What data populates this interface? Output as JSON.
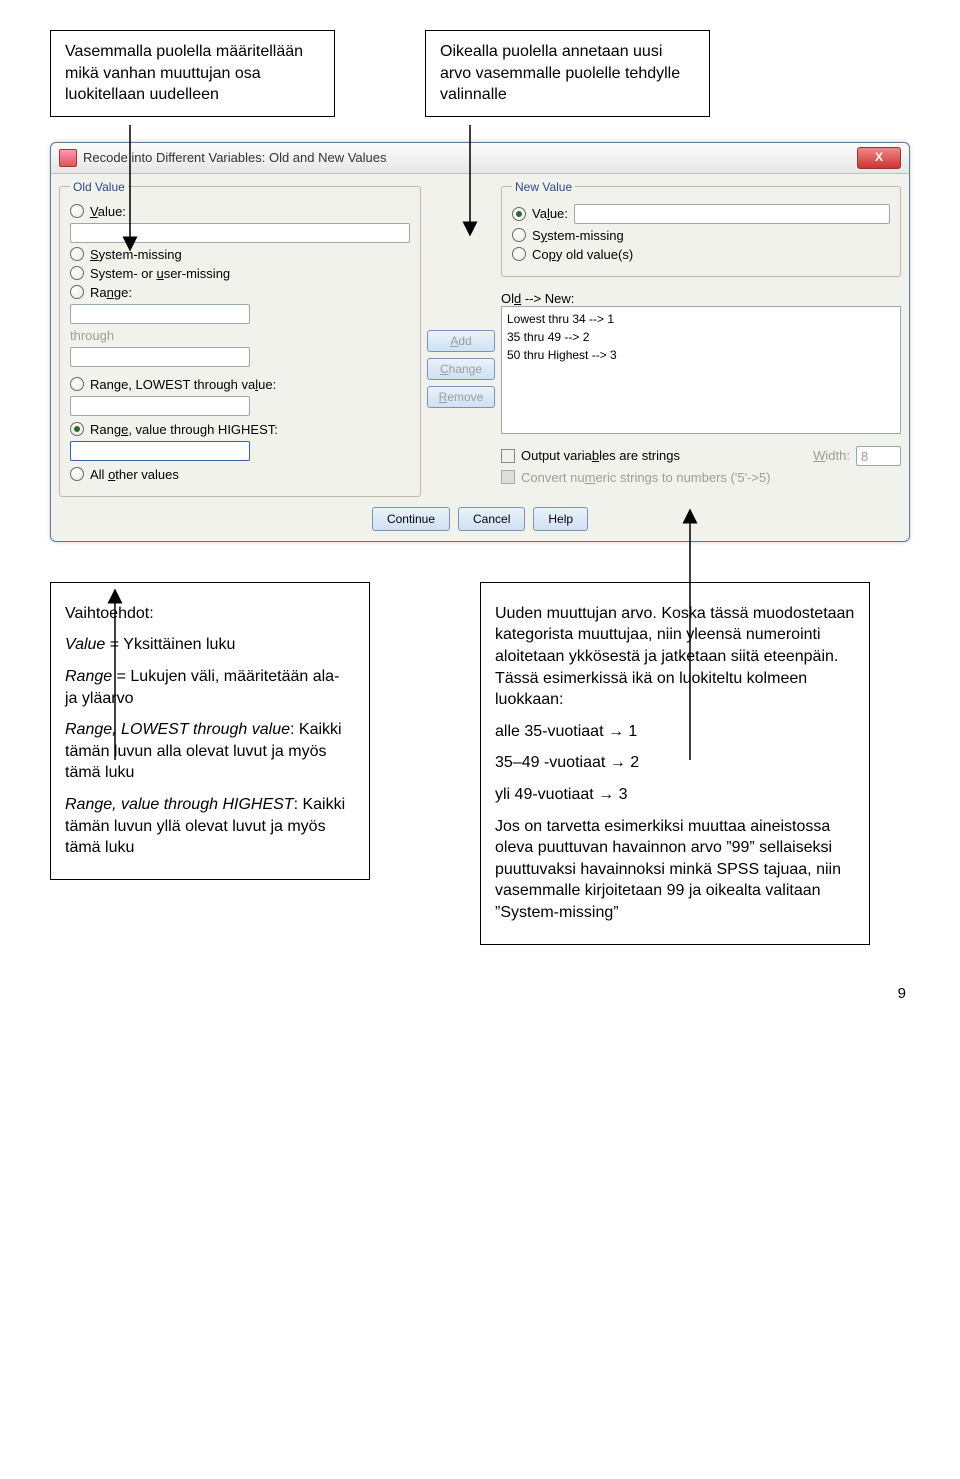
{
  "top_callouts": {
    "left": "Vasemmalla puolella määritellään mikä vanhan muuttujan osa luokitellaan uudelleen",
    "right": "Oikealla puolella annetaan uusi arvo vasemmalle puolelle tehdylle valinnalle"
  },
  "dialog": {
    "title": "Recode into Different Variables: Old and New Values",
    "close_glyph": "X",
    "old_value_legend": "Old Value",
    "new_value_legend": "New Value",
    "opt_value": "Value:",
    "opt_system_missing": "System-missing",
    "opt_system_or_user_missing": "System- or user-missing",
    "opt_range": "Range:",
    "through": "through",
    "opt_range_lowest": "Range, LOWEST through value:",
    "opt_range_highest": "Range, value through HIGHEST:",
    "opt_all_other": "All other values",
    "nv_value": "Value:",
    "nv_system_missing": "System-missing",
    "nv_copy_old": "Copy old value(s)",
    "old_new_label": "Old --> New:",
    "mapping_rows": [
      "Lowest thru 34 --> 1",
      "35 thru 49 --> 2",
      "50 thru Highest --> 3"
    ],
    "btn_add": "Add",
    "btn_change": "Change",
    "btn_remove": "Remove",
    "chk_output_strings": "Output variables are strings",
    "width_label": "Width:",
    "width_value": "8",
    "chk_convert_numeric": "Convert numeric strings to numbers ('5'->5)",
    "btn_continue": "Continue",
    "btn_cancel": "Cancel",
    "btn_help": "Help"
  },
  "bottom_callouts": {
    "left": {
      "heading": "Vaihtoehdot:",
      "items": [
        {
          "term": "Value",
          "desc": " = Yksittäinen luku"
        },
        {
          "term": "Range",
          "desc": " = Lukujen väli, määritetään ala- ja yläarvo"
        },
        {
          "term": "Range, LOWEST through value",
          "desc": ": Kaikki tämän luvun alla olevat luvut ja myös tämä luku"
        },
        {
          "term": "Range, value through HIGHEST",
          "desc": ": Kaikki tämän luvun yllä olevat luvut ja myös tämä luku"
        }
      ]
    },
    "right": {
      "p1": "Uuden muuttujan arvo. Koska tässä muodostetaan kategorista muuttujaa, niin yleensä numerointi aloitetaan ykkösestä ja jatketaan siitä eteenpäin. Tässä esimerkissä ikä on luokiteltu kolmeen luokkaan:",
      "items": [
        "alle 35-vuotiaat → 1",
        "35–49 -vuotiaat → 2",
        "yli 49-vuotiaat → 3"
      ],
      "p2": "Jos on tarvetta esimerkiksi muuttaa aineistossa oleva puuttuvan havainnon arvo ”99” sellaiseksi puuttuvaksi havainnoksi minkä SPSS tajuaa, niin vasemmalle kirjoitetaan 99 ja oikealta valitaan ”System-missing”"
    }
  },
  "page_number": "9"
}
